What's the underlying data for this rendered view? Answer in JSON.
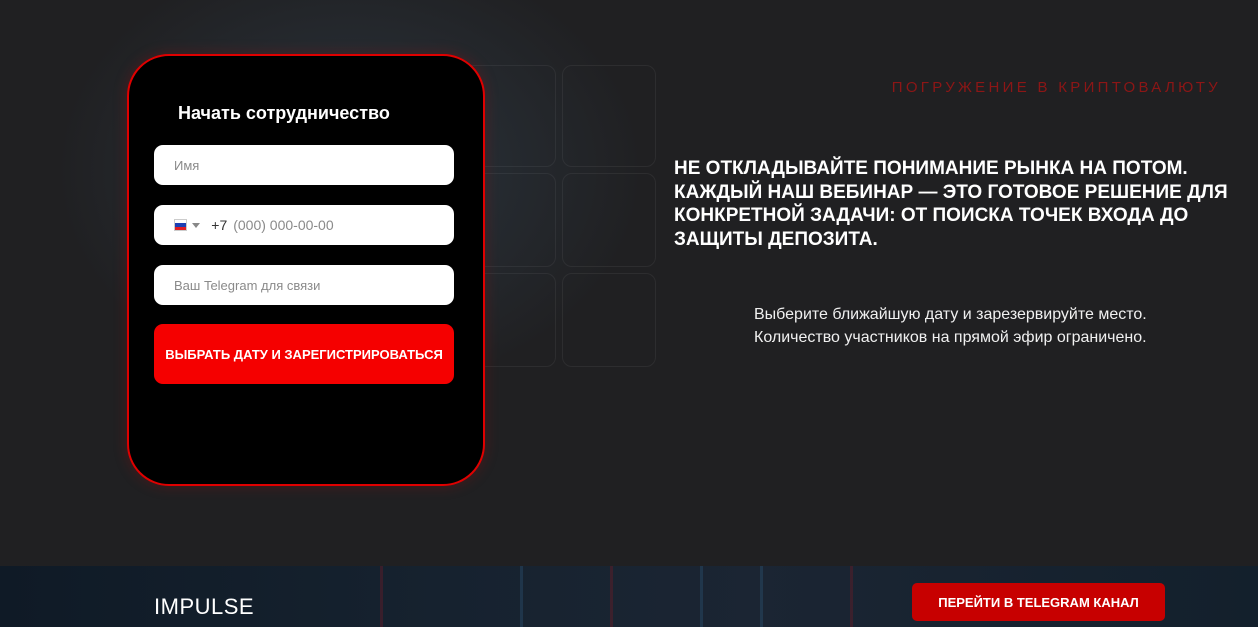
{
  "form": {
    "title": "Начать сотрудничество",
    "name_placeholder": "Имя",
    "phone": {
      "country": "RU",
      "code": "+7",
      "placeholder": "(000) 000-00-00"
    },
    "telegram_placeholder": "Ваш Telegram для связи",
    "submit_label": "ВЫБРАТЬ ДАТУ И ЗАРЕГИСТРИРОВАТЬСЯ"
  },
  "info": {
    "eyebrow": "ПОГРУЖЕНИЕ В КРИПТОВАЛЮТУ",
    "headline": "НЕ ОТКЛАДЫВАЙТЕ ПОНИМАНИЕ РЫНКА НА ПОТОМ. КАЖДЫЙ НАШ ВЕБИНАР — ЭТО ГОТОВОЕ РЕШЕНИЕ ДЛЯ КОНКРЕТНОЙ ЗАДАЧИ: ОТ ПОИСКА ТОЧЕК ВХОДА ДО ЗАЩИТЫ ДЕПОЗИТА.",
    "subtext_line1": "Выберите ближайшую дату и зарезервируйте место.",
    "subtext_line2": "Количество участников на прямой эфир ограничено."
  },
  "footer": {
    "brand": "IMPULSE",
    "telegram_button": "ПЕРЕЙТИ В TELEGRAM КАНАЛ"
  },
  "colors": {
    "accent": "#f50000",
    "background": "#202022",
    "eyebrow": "#8c1616"
  }
}
